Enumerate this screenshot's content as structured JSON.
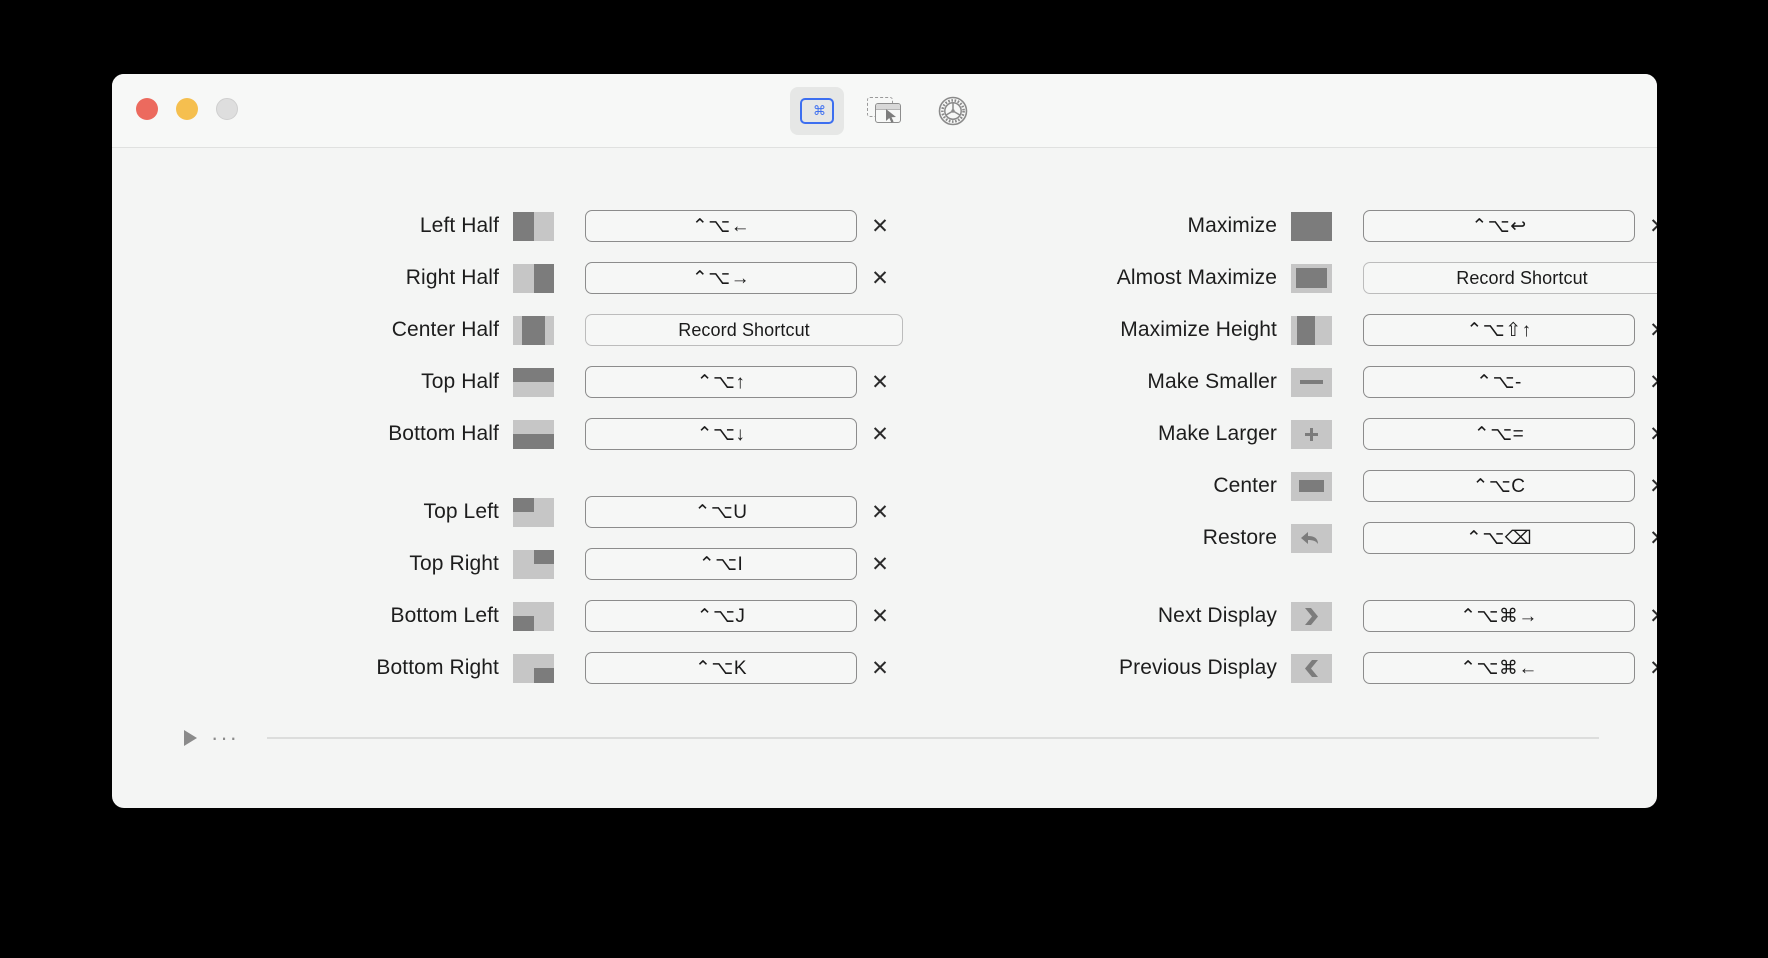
{
  "window": {
    "traffic_lights": {
      "close_color": "#ec6a5e",
      "minimize_color": "#f5bf4f",
      "zoom_color": "#dedede"
    },
    "background_color": "#f4f5f4"
  },
  "toolbar": {
    "accent_color": "#3d6ff0",
    "items": [
      {
        "name": "shortcuts-tab",
        "icon": "command-window-icon",
        "glyph": "⌘",
        "selected": true
      },
      {
        "name": "snap-areas-tab",
        "icon": "snap-window-cursor-icon",
        "glyph": "➤",
        "selected": false
      },
      {
        "name": "settings-tab",
        "icon": "gear-icon",
        "glyph": "⚙",
        "selected": false
      }
    ]
  },
  "left_column": [
    {
      "label": "Left Half",
      "icon": "window-left-half-icon",
      "shortcut": "⌃⌥←",
      "has_shortcut": true,
      "record_label": "Record Shortcut",
      "clear_label": "✕"
    },
    {
      "label": "Right Half",
      "icon": "window-right-half-icon",
      "shortcut": "⌃⌥→",
      "has_shortcut": true,
      "record_label": "Record Shortcut",
      "clear_label": "✕"
    },
    {
      "label": "Center Half",
      "icon": "window-center-half-icon",
      "shortcut": "",
      "has_shortcut": false,
      "record_label": "Record Shortcut",
      "clear_label": "✕"
    },
    {
      "label": "Top Half",
      "icon": "window-top-half-icon",
      "shortcut": "⌃⌥↑",
      "has_shortcut": true,
      "record_label": "Record Shortcut",
      "clear_label": "✕"
    },
    {
      "label": "Bottom Half",
      "icon": "window-bottom-half-icon",
      "shortcut": "⌃⌥↓",
      "has_shortcut": true,
      "record_label": "Record Shortcut",
      "clear_label": "✕"
    },
    {
      "label": "Top Left",
      "icon": "window-top-left-icon",
      "shortcut": "⌃⌥U",
      "has_shortcut": true,
      "record_label": "Record Shortcut",
      "clear_label": "✕"
    },
    {
      "label": "Top Right",
      "icon": "window-top-right-icon",
      "shortcut": "⌃⌥I",
      "has_shortcut": true,
      "record_label": "Record Shortcut",
      "clear_label": "✕"
    },
    {
      "label": "Bottom Left",
      "icon": "window-bottom-left-icon",
      "shortcut": "⌃⌥J",
      "has_shortcut": true,
      "record_label": "Record Shortcut",
      "clear_label": "✕"
    },
    {
      "label": "Bottom Right",
      "icon": "window-bottom-right-icon",
      "shortcut": "⌃⌥K",
      "has_shortcut": true,
      "record_label": "Record Shortcut",
      "clear_label": "✕"
    }
  ],
  "right_column": [
    {
      "label": "Maximize",
      "icon": "window-maximize-icon",
      "shortcut": "⌃⌥↩",
      "has_shortcut": true,
      "record_label": "Record Shortcut",
      "clear_label": "✕"
    },
    {
      "label": "Almost Maximize",
      "icon": "window-almost-maximize-icon",
      "shortcut": "",
      "has_shortcut": false,
      "record_label": "Record Shortcut",
      "clear_label": "✕"
    },
    {
      "label": "Maximize Height",
      "icon": "window-maximize-height-icon",
      "shortcut": "⌃⌥⇧↑",
      "has_shortcut": true,
      "record_label": "Record Shortcut",
      "clear_label": "✕"
    },
    {
      "label": "Make Smaller",
      "icon": "window-make-smaller-icon",
      "shortcut": "⌃⌥-",
      "has_shortcut": true,
      "record_label": "Record Shortcut",
      "clear_label": "✕"
    },
    {
      "label": "Make Larger",
      "icon": "window-make-larger-icon",
      "shortcut": "⌃⌥=",
      "has_shortcut": true,
      "record_label": "Record Shortcut",
      "clear_label": "✕"
    },
    {
      "label": "Center",
      "icon": "window-center-icon",
      "shortcut": "⌃⌥C",
      "has_shortcut": true,
      "record_label": "Record Shortcut",
      "clear_label": "✕"
    },
    {
      "label": "Restore",
      "icon": "window-restore-icon",
      "shortcut": "⌃⌥⌫",
      "has_shortcut": true,
      "record_label": "Record Shortcut",
      "clear_label": "✕"
    },
    {
      "label": "Next Display",
      "icon": "next-display-icon",
      "shortcut": "⌃⌥⌘→",
      "has_shortcut": true,
      "record_label": "Record Shortcut",
      "clear_label": "✕"
    },
    {
      "label": "Previous Display",
      "icon": "previous-display-icon",
      "shortcut": "⌃⌥⌘←",
      "has_shortcut": true,
      "record_label": "Record Shortcut",
      "clear_label": "✕"
    }
  ],
  "footer": {
    "disclosure_icon": "disclosure-triangle-icon",
    "ellipsis": "···"
  },
  "colors": {
    "icon_active": "#7c7c7c",
    "icon_inactive": "#c6c6c6",
    "border": "#8c8c8c",
    "border_light": "#bcbcbc"
  }
}
